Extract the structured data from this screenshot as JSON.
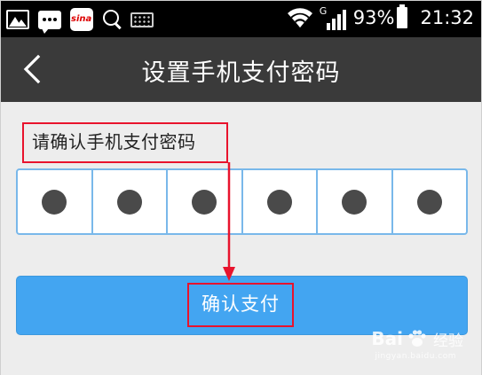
{
  "status_bar": {
    "battery_percent": "93%",
    "time": "21:32",
    "network_type": "G",
    "sina_text": "sina",
    "icons": [
      "image-icon",
      "message-icon",
      "sina-app-icon",
      "search-icon",
      "keyboard-icon",
      "wifi-icon",
      "signal-icon",
      "battery-icon"
    ]
  },
  "header": {
    "title": "设置手机支付密码",
    "back_icon": "chevron-left-icon"
  },
  "form": {
    "prompt": "请确认手机支付密码",
    "pin_length": 6,
    "pin_filled": 6,
    "confirm_label": "确认支付"
  },
  "watermark": {
    "brand_left": "Bai",
    "brand_right": "经验",
    "url": "jingyan.baidu.com"
  },
  "colors": {
    "header_bg": "#3a3a3a",
    "accent_blue": "#43a5f1",
    "pin_border": "#79b8ea",
    "annotation_red": "#e8132d",
    "page_bg": "#ededed"
  }
}
